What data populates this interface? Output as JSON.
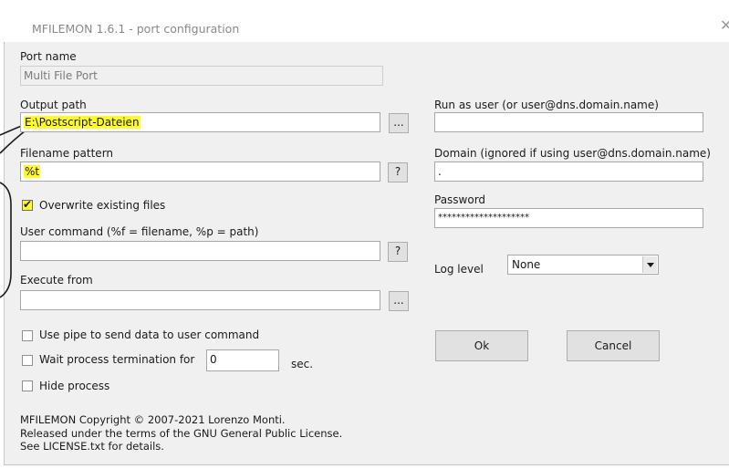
{
  "window": {
    "title": "MFILEMON 1.6.1 - port configuration",
    "close_glyph": "✕"
  },
  "port_name": {
    "label": "Port name",
    "value": "Multi File Port"
  },
  "output_path": {
    "label": "Output path",
    "value": "E:\\Postscript-Dateien",
    "browse_label": "..."
  },
  "filename_pattern": {
    "label": "Filename pattern",
    "value": "%t",
    "help_label": "?"
  },
  "overwrite": {
    "label": "Overwrite existing files",
    "checked": true
  },
  "user_command": {
    "label": "User command (%f = filename, %p = path)",
    "value": "",
    "help_label": "?"
  },
  "execute_from": {
    "label": "Execute from",
    "value": "",
    "browse_label": "..."
  },
  "use_pipe": {
    "label": "Use pipe to send data to user command",
    "checked": false
  },
  "wait_process": {
    "label": "Wait process termination for",
    "value": "0",
    "unit": "sec.",
    "checked": false
  },
  "hide_process": {
    "label": "Hide process",
    "checked": false
  },
  "run_as_user": {
    "label": "Run as user (or user@dns.domain.name)",
    "value": ""
  },
  "domain": {
    "label": "Domain (ignored if using user@dns.domain.name)",
    "value": "."
  },
  "password": {
    "label": "Password",
    "value": "********************"
  },
  "log_level": {
    "label": "Log level",
    "value": "None"
  },
  "buttons": {
    "ok": "Ok",
    "cancel": "Cancel"
  },
  "footer": {
    "line1": "MFILEMON Copyright © 2007-2021 Lorenzo Monti.",
    "line2": "Released under the terms of the GNU General Public License.",
    "line3": "See LICENSE.txt for details."
  },
  "colors": {
    "highlight": "#fffb2a",
    "annotation": "#1a1a1a",
    "dialog_bg": "#f0f0f0"
  }
}
